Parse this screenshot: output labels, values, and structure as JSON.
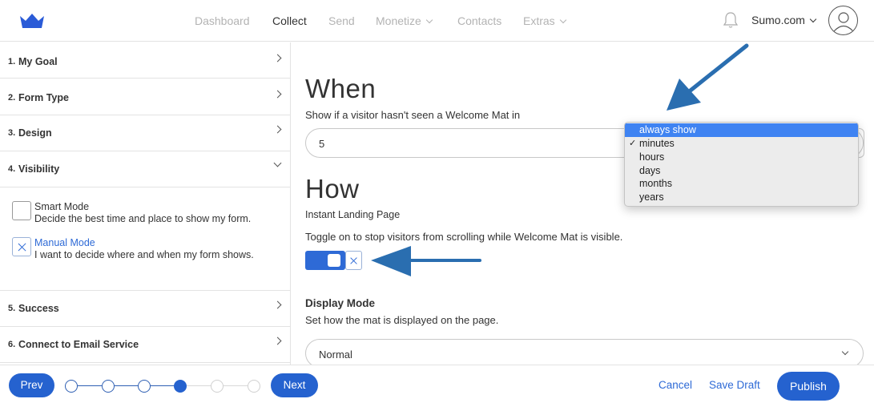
{
  "nav": {
    "items": [
      {
        "label": "Dashboard"
      },
      {
        "label": "Collect"
      },
      {
        "label": "Send"
      },
      {
        "label": "Monetize"
      },
      {
        "label": "Contacts"
      },
      {
        "label": "Extras"
      }
    ],
    "account_label": "Sumo.com",
    "logo_icon": "crown-icon",
    "bell_icon": "bell-icon",
    "avatar_icon": "user-icon"
  },
  "sidebar": {
    "steps": [
      {
        "num": "1.",
        "label": "My Goal"
      },
      {
        "num": "2.",
        "label": "Form Type"
      },
      {
        "num": "3.",
        "label": "Design"
      },
      {
        "num": "4.",
        "label": "Visibility"
      },
      {
        "num": "5.",
        "label": "Success"
      },
      {
        "num": "6.",
        "label": "Connect to Email Service"
      }
    ],
    "modes": [
      {
        "title": "Smart Mode",
        "desc": "Decide the best time and place to show my form.",
        "checked": false
      },
      {
        "title": "Manual Mode",
        "desc": "I want to decide where and when my form shows.",
        "checked": true
      }
    ]
  },
  "main": {
    "when_title": "When",
    "when_desc": "Show if a visitor hasn't seen a Welcome Mat in",
    "when_value": "5",
    "unit_options": [
      "always show",
      "minutes",
      "hours",
      "days",
      "months",
      "years"
    ],
    "unit_highlighted": "always show",
    "unit_selected": "minutes",
    "how_title": "How",
    "how_subtitle": "Instant Landing Page",
    "how_desc": "Toggle on to stop visitors from scrolling while Welcome Mat is visible.",
    "toggle_on": true,
    "display_title": "Display Mode",
    "display_desc": "Set how the mat is displayed on the page.",
    "display_value": "Normal"
  },
  "footer": {
    "prev_label": "Prev",
    "next_label": "Next",
    "cancel_label": "Cancel",
    "save_label": "Save Draft",
    "publish_label": "Publish",
    "progress_current_step": 4,
    "progress_total_steps": 6
  },
  "colors": {
    "accent": "#2562cf",
    "arrow": "#2a6eb0",
    "highlight": "#3f83f2"
  }
}
